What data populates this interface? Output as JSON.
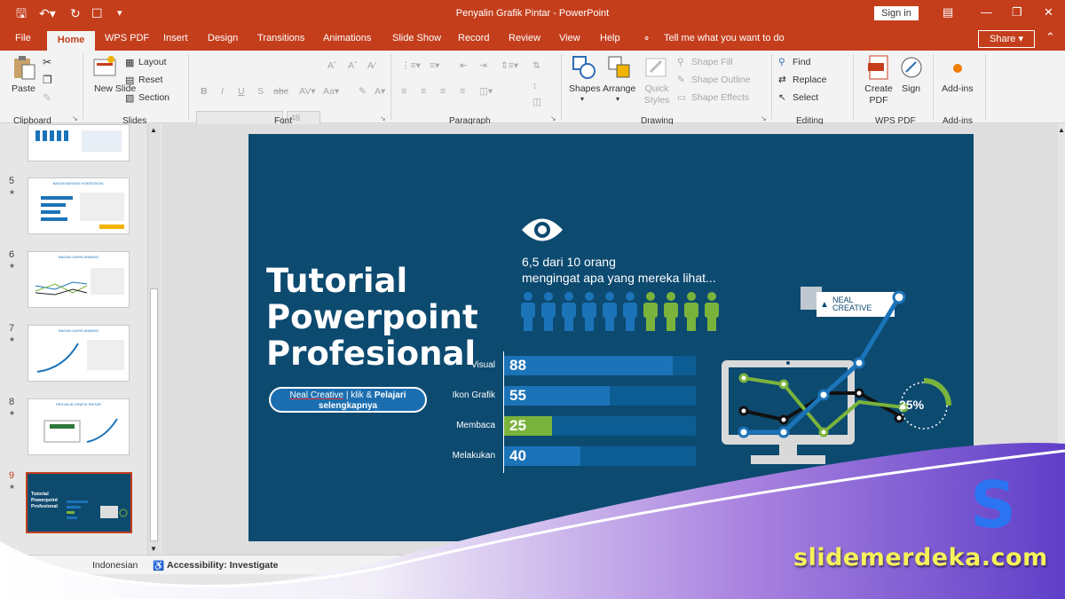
{
  "window": {
    "title": "Penyalin Grafik Pintar  -  PowerPoint",
    "sign_in": "Sign in"
  },
  "menu": {
    "items": [
      "File",
      "Home",
      "WPS PDF",
      "Insert",
      "Design",
      "Transitions",
      "Animations",
      "Slide Show",
      "Record",
      "Review",
      "View",
      "Help"
    ],
    "tell_me": "Tell me what you want to do",
    "share": "Share"
  },
  "ribbon": {
    "clipboard": {
      "paste": "Paste",
      "group": "Clipboard"
    },
    "slides": {
      "new_slide": "New Slide",
      "layout": "Layout",
      "reset": "Reset",
      "section": "Section",
      "group": "Slides"
    },
    "font": {
      "size": "48",
      "group": "Font"
    },
    "paragraph": {
      "group": "Paragraph"
    },
    "drawing": {
      "shapes": "Shapes",
      "arrange": "Arrange",
      "quick_styles": "Quick Styles",
      "shape_fill": "Shape Fill",
      "shape_outline": "Shape Outline",
      "shape_effects": "Shape Effects",
      "group": "Drawing"
    },
    "editing": {
      "find": "Find",
      "replace": "Replace",
      "select": "Select",
      "group": "Editing"
    },
    "wps": {
      "create_pdf": "Create PDF",
      "sign": "Sign",
      "group": "WPS PDF"
    },
    "addins": {
      "label": "Add-ins",
      "group": "Add-ins"
    }
  },
  "thumbnails": [
    {
      "num": "5",
      "title": "BAGAN BATANG HORIZONTAL"
    },
    {
      "num": "6",
      "title": "BAGAN GARIS ANIMASI"
    },
    {
      "num": "7",
      "title": "BAGAN GARIS ANIMASI"
    },
    {
      "num": "8",
      "title": "PENYALIN GRAFIK PINTAR"
    },
    {
      "num": "9",
      "title": "Tutorial Powerpoint Profesional"
    }
  ],
  "slide": {
    "title_lines": [
      "Tutorial",
      "Powerpoint",
      "Profesional"
    ],
    "pill_link": "Neal Creative",
    "pill_rest": " | klik & ",
    "pill_bold": "Pelajari selengkapnya",
    "stat_line1": "6,5 dari 10 orang",
    "stat_line2": "mengingat apa yang mereka lihat...",
    "logo_text_1": "NEAL",
    "logo_text_2": "CREATIVE",
    "percent": "25%",
    "people": {
      "total": 10,
      "highlighted": 6
    }
  },
  "chart_data": {
    "type": "bar",
    "categories": [
      "Visual",
      "Ikon Grafik",
      "Membaca",
      "Melakukan"
    ],
    "values": [
      88,
      55,
      25,
      40
    ],
    "colors": [
      "#1b73b8",
      "#1b73b8",
      "#7ab33c",
      "#1b73b8"
    ],
    "xlim": [
      0,
      100
    ]
  },
  "statusbar": {
    "language": "Indonesian",
    "accessibility": "Accessibility: Investigate"
  },
  "watermark": {
    "logo": "S",
    "site": "slidemerdeka.com"
  },
  "colors": {
    "accent": "#c43e1c",
    "slide_bg": "#0d4a70",
    "bar_blue": "#1b73b8",
    "bar_green": "#7ab33c",
    "brand_yellow": "#f6f25a"
  }
}
